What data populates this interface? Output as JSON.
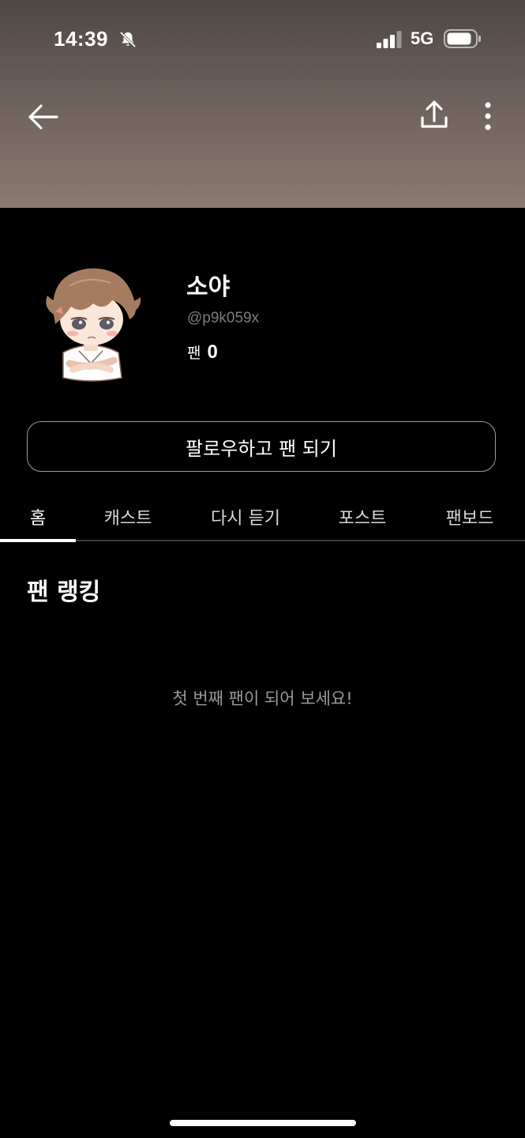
{
  "status_bar": {
    "time": "14:39",
    "network": "5G",
    "icons": [
      "bell-off-icon",
      "signal-icon",
      "battery-icon"
    ]
  },
  "toolbar": {
    "icons": [
      "back-arrow-icon",
      "share-icon",
      "more-vertical-icon"
    ]
  },
  "profile": {
    "name": "소야",
    "handle": "@p9k059x",
    "fans_label": "팬",
    "fans_count": "0"
  },
  "follow_button": {
    "label": "팔로우하고 팬 되기"
  },
  "tabs": [
    {
      "label": "홈",
      "active": true
    },
    {
      "label": "캐스트",
      "active": false
    },
    {
      "label": "다시 듣기",
      "active": false
    },
    {
      "label": "포스트",
      "active": false
    },
    {
      "label": "팬보드",
      "active": false
    }
  ],
  "fan_ranking": {
    "title": "팬 랭킹",
    "empty_message": "첫 번째 팬이 되어 보세요!"
  },
  "colors": {
    "background": "#000000",
    "header_top": "#4e4744",
    "header_bottom": "#8a7a70",
    "muted_text": "#9a9a9a"
  }
}
